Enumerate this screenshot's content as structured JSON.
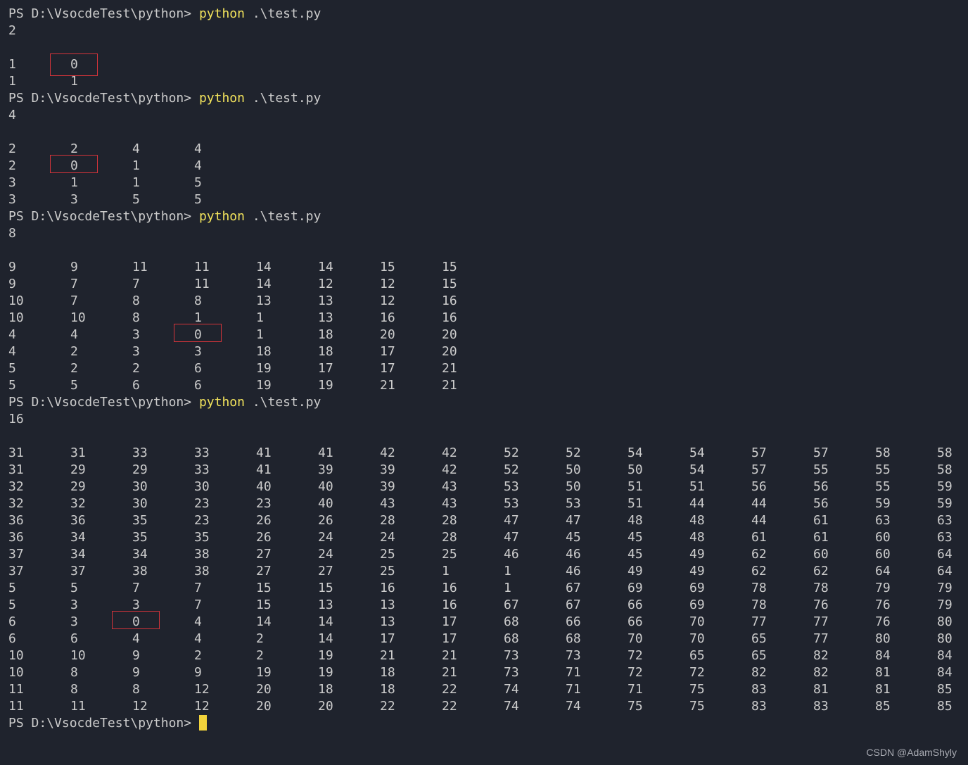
{
  "terminal": {
    "prompt": "PS D:\\VsocdeTest\\python>",
    "command": "python",
    "argument": ".\\test.py",
    "runs": [
      {
        "input": "2",
        "rows": [
          [
            "1",
            "0"
          ],
          [
            "1",
            "1"
          ]
        ],
        "highlight": [
          0,
          1
        ]
      },
      {
        "input": "4",
        "rows": [
          [
            "2",
            "2",
            "4",
            "4"
          ],
          [
            "2",
            "0",
            "1",
            "4"
          ],
          [
            "3",
            "1",
            "1",
            "5"
          ],
          [
            "3",
            "3",
            "5",
            "5"
          ]
        ],
        "highlight": [
          1,
          1
        ]
      },
      {
        "input": "8",
        "rows": [
          [
            "9",
            "9",
            "11",
            "11",
            "14",
            "14",
            "15",
            "15"
          ],
          [
            "9",
            "7",
            "7",
            "11",
            "14",
            "12",
            "12",
            "15"
          ],
          [
            "10",
            "7",
            "8",
            "8",
            "13",
            "13",
            "12",
            "16"
          ],
          [
            "10",
            "10",
            "8",
            "1",
            "1",
            "13",
            "16",
            "16"
          ],
          [
            "4",
            "4",
            "3",
            "0",
            "1",
            "18",
            "20",
            "20"
          ],
          [
            "4",
            "2",
            "3",
            "3",
            "18",
            "18",
            "17",
            "20"
          ],
          [
            "5",
            "2",
            "2",
            "6",
            "19",
            "17",
            "17",
            "21"
          ],
          [
            "5",
            "5",
            "6",
            "6",
            "19",
            "19",
            "21",
            "21"
          ]
        ],
        "highlight": [
          4,
          3
        ]
      },
      {
        "input": "16",
        "rows": [
          [
            "31",
            "31",
            "33",
            "33",
            "41",
            "41",
            "42",
            "42",
            "52",
            "52",
            "54",
            "54",
            "57",
            "57",
            "58",
            "58"
          ],
          [
            "31",
            "29",
            "29",
            "33",
            "41",
            "39",
            "39",
            "42",
            "52",
            "50",
            "50",
            "54",
            "57",
            "55",
            "55",
            "58"
          ],
          [
            "32",
            "29",
            "30",
            "30",
            "40",
            "40",
            "39",
            "43",
            "53",
            "50",
            "51",
            "51",
            "56",
            "56",
            "55",
            "59"
          ],
          [
            "32",
            "32",
            "30",
            "23",
            "23",
            "40",
            "43",
            "43",
            "53",
            "53",
            "51",
            "44",
            "44",
            "56",
            "59",
            "59"
          ],
          [
            "36",
            "36",
            "35",
            "23",
            "26",
            "26",
            "28",
            "28",
            "47",
            "47",
            "48",
            "48",
            "44",
            "61",
            "63",
            "63"
          ],
          [
            "36",
            "34",
            "35",
            "35",
            "26",
            "24",
            "24",
            "28",
            "47",
            "45",
            "45",
            "48",
            "61",
            "61",
            "60",
            "63"
          ],
          [
            "37",
            "34",
            "34",
            "38",
            "27",
            "24",
            "25",
            "25",
            "46",
            "46",
            "45",
            "49",
            "62",
            "60",
            "60",
            "64"
          ],
          [
            "37",
            "37",
            "38",
            "38",
            "27",
            "27",
            "25",
            "1",
            "1",
            "46",
            "49",
            "49",
            "62",
            "62",
            "64",
            "64"
          ],
          [
            "5",
            "5",
            "7",
            "7",
            "15",
            "15",
            "16",
            "16",
            "1",
            "67",
            "69",
            "69",
            "78",
            "78",
            "79",
            "79"
          ],
          [
            "5",
            "3",
            "3",
            "7",
            "15",
            "13",
            "13",
            "16",
            "67",
            "67",
            "66",
            "69",
            "78",
            "76",
            "76",
            "79"
          ],
          [
            "6",
            "3",
            "0",
            "4",
            "14",
            "14",
            "13",
            "17",
            "68",
            "66",
            "66",
            "70",
            "77",
            "77",
            "76",
            "80"
          ],
          [
            "6",
            "6",
            "4",
            "4",
            "2",
            "14",
            "17",
            "17",
            "68",
            "68",
            "70",
            "70",
            "65",
            "77",
            "80",
            "80"
          ],
          [
            "10",
            "10",
            "9",
            "2",
            "2",
            "19",
            "21",
            "21",
            "73",
            "73",
            "72",
            "65",
            "65",
            "82",
            "84",
            "84"
          ],
          [
            "10",
            "8",
            "9",
            "9",
            "19",
            "19",
            "18",
            "21",
            "73",
            "71",
            "72",
            "72",
            "82",
            "82",
            "81",
            "84"
          ],
          [
            "11",
            "8",
            "8",
            "12",
            "20",
            "18",
            "18",
            "22",
            "74",
            "71",
            "71",
            "75",
            "83",
            "81",
            "81",
            "85"
          ],
          [
            "11",
            "11",
            "12",
            "12",
            "20",
            "20",
            "22",
            "22",
            "74",
            "74",
            "75",
            "75",
            "83",
            "83",
            "85",
            "85"
          ]
        ],
        "highlight": [
          10,
          2
        ]
      }
    ]
  },
  "watermark": "CSDN @AdamShyly",
  "colors": {
    "background": "#1f232d",
    "text": "#cccccc",
    "command": "#f2e35c",
    "highlight_box": "#d4343a",
    "cursor": "#f2d33b"
  }
}
